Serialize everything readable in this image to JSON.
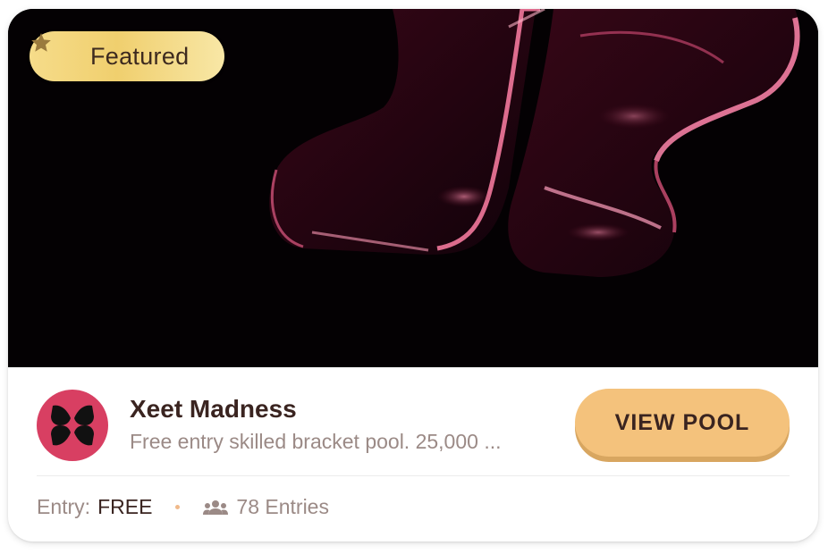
{
  "badge": {
    "label": "Featured",
    "icon": "star-icon"
  },
  "pool": {
    "name": "Xeet Madness",
    "description": "Free entry skilled bracket pool. 25,000 ...",
    "cta_label": "VIEW POOL"
  },
  "meta": {
    "entry_label": "Entry:",
    "entry_value": "FREE",
    "entries_text": "78 Entries",
    "entries_icon": "people-icon"
  },
  "colors": {
    "logo_bg": "#d83f62",
    "cta_bg": "#f4c27c",
    "badge_gold": "#f0cf6e"
  }
}
